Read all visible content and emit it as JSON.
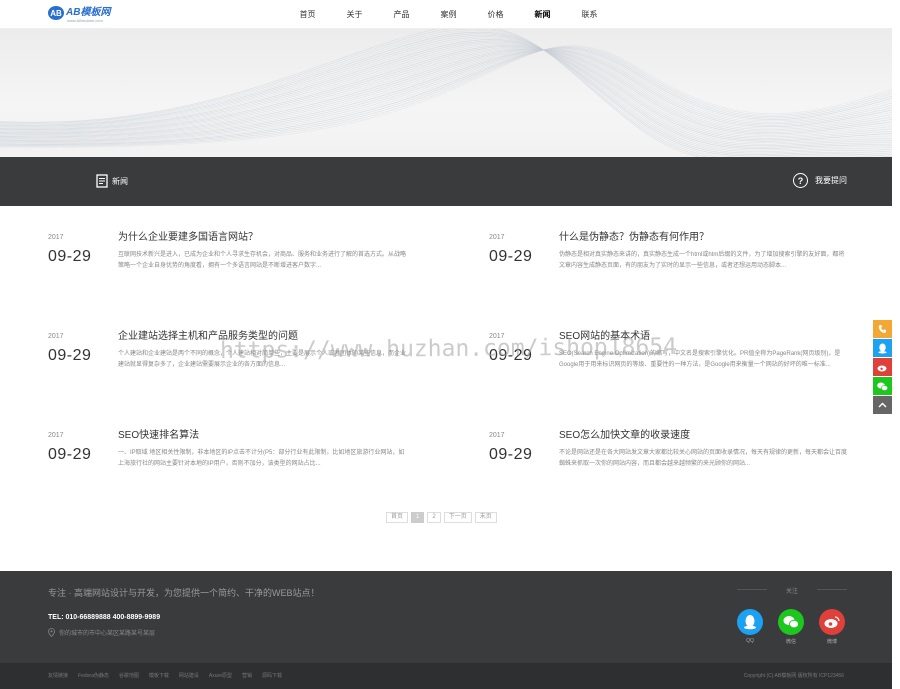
{
  "header": {
    "logo_mark": "AB",
    "logo_text": "AB模板网",
    "logo_sub": "www.ABmoban.com",
    "nav": [
      {
        "label": "首页"
      },
      {
        "label": "关于"
      },
      {
        "label": "产品"
      },
      {
        "label": "案例"
      },
      {
        "label": "价格"
      },
      {
        "label": "新闻"
      },
      {
        "label": "联系"
      }
    ]
  },
  "section": {
    "title": "新闻",
    "help_label": "我要提问"
  },
  "news": [
    {
      "year": "2017",
      "date": "09-29",
      "title": "为什么企业要建多国语言网站？",
      "summary": "互联网技术新兴是进入，已成为企业和个人寻求生存机会，对商品、服务和业务进行了解的首选方式。从战略策略一个企业自身优势的角度看，拥有一个多语言网站是不断增进客户数字..."
    },
    {
      "year": "2017",
      "date": "09-29",
      "title": "什么是伪静态？伪静态有何作用？",
      "summary": "伪静态是相对真实静态来讲的，真实静态生成一个html或htm后缀的文件，为了增加搜索引擎的友好面，都将文章内容生成静态页面，有的朋友为了实时的显示一些信息，或者还想运用动态脚本..."
    },
    {
      "year": "2017",
      "date": "09-29",
      "title": "企业建站选择主机和产品服务类型的问题",
      "summary": "个人建站和企业建站是两个不同的概念，个人建站相对简单些，主要是展示个人或者团体的某些信息，而企业建站就显得复杂多了，企业建站需要展示企业的各方面的信息..."
    },
    {
      "year": "2017",
      "date": "09-29",
      "title": "SEO网站的基本术语",
      "summary": "SEO(Search Engine Optimization)的缩写，中文名是搜索引擎优化。PR值全称为PageRank(网页级别)，是Google用于用来标识网页的等级、重要性的一种方法，是Google用来衡量一个网站的好坏的唯一标准..."
    },
    {
      "year": "2017",
      "date": "09-29",
      "title": "SEO快速排名算法",
      "summary": "一、IP取域 地区相关性限制，非本地区的IP点击不计分(P5：部分行业有此限制，比如地区旅游行业网站，如上海旅行社的网站主要针对本地的IP用户，否则不加分，该类型的网站占比..."
    },
    {
      "year": "2017",
      "date": "09-29",
      "title": "SEO怎么加快文章的收录速度",
      "summary": "不论是网站还是在各大网站发文章大家都比较关心网站的页面收录情况，每天有规律的更新，每天都会让百度蜘蛛来抓取一次你的网站内容，而且都会越来越频繁的来光顾你的网站..."
    }
  ],
  "pagination": {
    "first": "首页",
    "pages": [
      "1",
      "2"
    ],
    "next": "下一页",
    "last": "末页"
  },
  "footer": {
    "slogan": "专注 · 高端网站设计与开发，为您提供一个简约、干净的WEB站点！",
    "tel": "TEL: 010-66889888 400-8899-9989",
    "address": "你的城市的市中心某区某路某号某层",
    "follow_label": "关注",
    "social": [
      {
        "label": "QQ",
        "color": "#1da1f2"
      },
      {
        "label": "微信",
        "color": "#1ec71e"
      },
      {
        "label": "微博",
        "color": "#e0403a"
      }
    ],
    "friend_links": [
      "友情链接",
      "Fedora伪静态",
      "谷歌地图",
      "模板下载",
      "网站建设",
      "Axure原型",
      "营销",
      "源码下载"
    ],
    "copyright": "Copyright (C) AB模板网 版权所有 ICP123456"
  },
  "sidebar": [
    {
      "icon": "phone-icon",
      "color": "#f3a833"
    },
    {
      "icon": "qq-icon",
      "color": "#1da1f2"
    },
    {
      "icon": "weibo-icon",
      "color": "#e0403a"
    },
    {
      "icon": "wechat-icon",
      "color": "#1ec71e"
    },
    {
      "icon": "back-to-top-icon",
      "color": "#666666"
    }
  ],
  "watermark": "https://www.huzhan.com/ishop18654"
}
